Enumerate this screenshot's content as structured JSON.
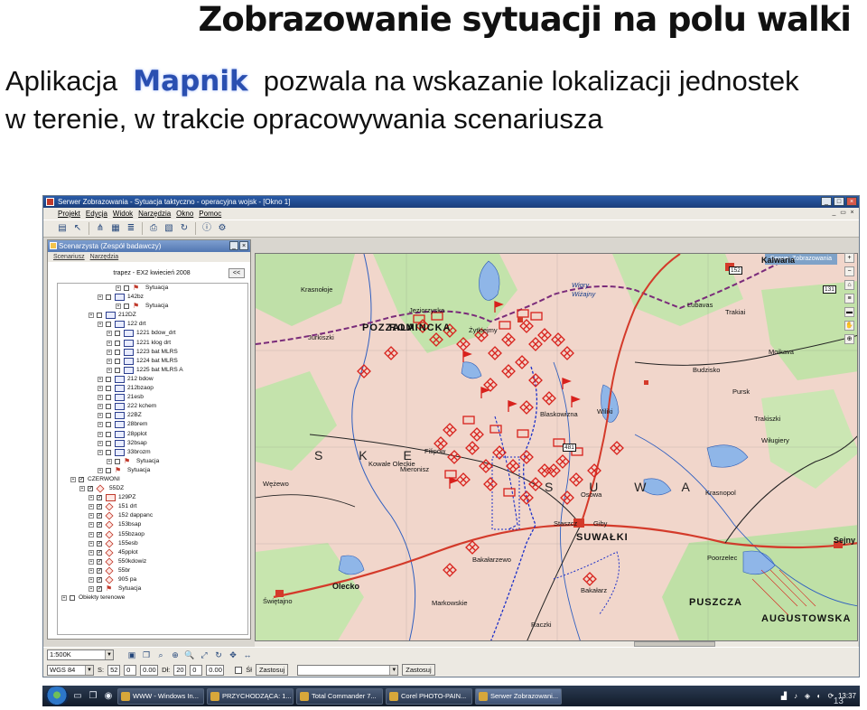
{
  "slide": {
    "title": "Zobrazowanie sytuacji na polu walki",
    "line1_before": "Aplikacja  ",
    "line1_app": "Mapnik",
    "line1_after": "  pozwala na wskazanie lokalizacji jednostek",
    "line2": "w terenie, w trakcie opracowywania scenariusza",
    "page_number": "13"
  },
  "window": {
    "title": "Serwer Zobrazowania - Sytuacja taktyczno - operacyjna wojsk - [Okno 1]",
    "menu": [
      "Projekt",
      "Edycja",
      "Widok",
      "Narzędzia",
      "Okno",
      "Pomoc"
    ],
    "toolbar_icons": [
      "new-icon",
      "cursor-icon",
      "network-icon",
      "grid-icon",
      "layers-icon",
      "print-icon",
      "map-icon",
      "refresh-icon",
      "info-icon",
      "settings-icon"
    ]
  },
  "panel": {
    "title": "Scenarzysta (Zespół badawczy)",
    "menu": [
      "Scenariusz",
      "Narzędzia"
    ],
    "header": "trapez - EX2 kwiecień 2008",
    "header_button": "<<",
    "tree": [
      {
        "label": "Sytuacja",
        "indent": 6,
        "checked": false,
        "sym": "flag"
      },
      {
        "label": "142bz",
        "indent": 4,
        "checked": false,
        "sym": "blue"
      },
      {
        "label": "Sytuacja",
        "indent": 6,
        "checked": false,
        "sym": "flag"
      },
      {
        "label": "212DZ",
        "indent": 3,
        "checked": false,
        "sym": "blue"
      },
      {
        "label": "122 drt",
        "indent": 4,
        "checked": false,
        "sym": "blue"
      },
      {
        "label": "1221 bdow_drt",
        "indent": 5,
        "checked": false,
        "sym": "blue"
      },
      {
        "label": "1221 klog drt",
        "indent": 5,
        "checked": false,
        "sym": "blue"
      },
      {
        "label": "1223 bat MLRS",
        "indent": 5,
        "checked": false,
        "sym": "blue"
      },
      {
        "label": "1224 bat MLRS",
        "indent": 5,
        "checked": false,
        "sym": "blue"
      },
      {
        "label": "1225 bat MLRS A",
        "indent": 5,
        "checked": false,
        "sym": "blue"
      },
      {
        "label": "212 bdow",
        "indent": 4,
        "checked": false,
        "sym": "blue"
      },
      {
        "label": "212bzaop",
        "indent": 4,
        "checked": false,
        "sym": "blue"
      },
      {
        "label": "21esb",
        "indent": 4,
        "checked": false,
        "sym": "blue"
      },
      {
        "label": "222 kchem",
        "indent": 4,
        "checked": false,
        "sym": "blue"
      },
      {
        "label": "22BZ",
        "indent": 4,
        "checked": false,
        "sym": "blue"
      },
      {
        "label": "28brem",
        "indent": 4,
        "checked": false,
        "sym": "blue"
      },
      {
        "label": "28pplot",
        "indent": 4,
        "checked": false,
        "sym": "blue"
      },
      {
        "label": "32bsap",
        "indent": 4,
        "checked": false,
        "sym": "blue"
      },
      {
        "label": "33brozm",
        "indent": 4,
        "checked": false,
        "sym": "blue"
      },
      {
        "label": "Sytuacja",
        "indent": 5,
        "checked": false,
        "sym": "flag"
      },
      {
        "label": "Sytuacja",
        "indent": 4,
        "checked": false,
        "sym": "flag"
      },
      {
        "label": "CZERWONI",
        "indent": 1,
        "checked": true,
        "sym": "none"
      },
      {
        "label": "55DZ",
        "indent": 2,
        "checked": true,
        "sym": "red-dia"
      },
      {
        "label": "129PZ",
        "indent": 3,
        "checked": true,
        "sym": "red"
      },
      {
        "label": "151 drt",
        "indent": 3,
        "checked": true,
        "sym": "red-dia"
      },
      {
        "label": "152 dappanc",
        "indent": 3,
        "checked": true,
        "sym": "red-dia"
      },
      {
        "label": "153bsap",
        "indent": 3,
        "checked": true,
        "sym": "red-dia"
      },
      {
        "label": "155bzaop",
        "indent": 3,
        "checked": true,
        "sym": "red-dia"
      },
      {
        "label": "155esb",
        "indent": 3,
        "checked": true,
        "sym": "red-dia"
      },
      {
        "label": "45pplot",
        "indent": 3,
        "checked": true,
        "sym": "red-dia"
      },
      {
        "label": "550kdowiz",
        "indent": 3,
        "checked": true,
        "sym": "red-dia"
      },
      {
        "label": "55br",
        "indent": 3,
        "checked": true,
        "sym": "red-dia"
      },
      {
        "label": "905 pa",
        "indent": 3,
        "checked": true,
        "sym": "red-dia"
      },
      {
        "label": "Sytuacja",
        "indent": 3,
        "checked": true,
        "sym": "flag"
      },
      {
        "label": "Obiekty terenowe",
        "indent": 0,
        "checked": false,
        "sym": "none"
      }
    ]
  },
  "map": {
    "caption": "Serwer Zobrazowania",
    "labels": [
      {
        "text": "Kalwaria",
        "kind": "bold"
      },
      {
        "text": "POZZALA",
        "kind": "big"
      },
      {
        "text": "ROMINCKA",
        "kind": "big"
      },
      {
        "text": "Jurkiszki",
        "kind": "plain"
      },
      {
        "text": "Krasnołoje",
        "kind": "plain"
      },
      {
        "text": "Żytkiejmy",
        "kind": "plain"
      },
      {
        "text": "Jeziorzyska",
        "kind": "plain"
      },
      {
        "text": "Lubavas",
        "kind": "plain"
      },
      {
        "text": "Trakiai",
        "kind": "plain"
      },
      {
        "text": "Moikava",
        "kind": "plain"
      },
      {
        "text": "Budzisko",
        "kind": "plain"
      },
      {
        "text": "Pursk",
        "kind": "plain"
      },
      {
        "text": "Blaskowizna",
        "kind": "plain"
      },
      {
        "text": "Filipów",
        "kind": "plain"
      },
      {
        "text": "Wiżajny",
        "kind": "water"
      },
      {
        "text": "Wiliki",
        "kind": "plain"
      },
      {
        "text": "Trakiszki",
        "kind": "plain"
      },
      {
        "text": "Wiługiery",
        "kind": "plain"
      },
      {
        "text": "S   K   E",
        "kind": "region"
      },
      {
        "text": "S  U  W  A",
        "kind": "region"
      },
      {
        "text": "Kowale Oleckie",
        "kind": "plain"
      },
      {
        "text": "Wężewo",
        "kind": "plain"
      },
      {
        "text": "Mieronisz",
        "kind": "plain"
      },
      {
        "text": "Osowa",
        "kind": "plain"
      },
      {
        "text": "Krasnopol",
        "kind": "plain"
      },
      {
        "text": "SUWAŁKI",
        "kind": "big"
      },
      {
        "text": "Bakałarzewo",
        "kind": "plain"
      },
      {
        "text": "Staszcz",
        "kind": "plain"
      },
      {
        "text": "Olecko",
        "kind": "bold"
      },
      {
        "text": "Świętajno",
        "kind": "plain"
      },
      {
        "text": "Markowskie",
        "kind": "plain"
      },
      {
        "text": "Raczki",
        "kind": "plain"
      },
      {
        "text": "Bakałarz",
        "kind": "plain"
      },
      {
        "text": "PUSZCZA",
        "kind": "big"
      },
      {
        "text": "AUGUSTOWSKA",
        "kind": "big"
      },
      {
        "text": "Sejny",
        "kind": "bold"
      },
      {
        "text": "Giby",
        "kind": "plain"
      },
      {
        "text": "Poorzelec",
        "kind": "plain"
      },
      {
        "text": "Wigry",
        "kind": "water"
      },
      {
        "text": "481",
        "kind": "num"
      },
      {
        "text": "131",
        "kind": "num"
      },
      {
        "text": "152",
        "kind": "num"
      }
    ],
    "right_tools": [
      "zoom-in-icon",
      "zoom-out-icon",
      "home-icon",
      "layer-icon",
      "folder-icon",
      "hand-icon",
      "target-icon"
    ]
  },
  "statusbar": {
    "scale": "1:500K",
    "scale_icons": [
      "image-icon",
      "copy-icon",
      "magnify-icon",
      "zoom-icon",
      "search-icon",
      "fit-icon",
      "refresh-icon",
      "pan-icon",
      "measure-icon"
    ],
    "datum": "WGS 84",
    "s_label": "S:",
    "s_value": "52",
    "s_min": "0",
    "s_sec": "0.00",
    "d_label": "Dł:",
    "d_value": "20",
    "d_min": "0",
    "d_sec": "0.00",
    "si_label": "Śł",
    "apply_button": "Zastosuj",
    "combo_value": "",
    "apply_button2": "Zastosuj"
  },
  "taskbar": {
    "tasks": [
      {
        "label": "WWW - Windows In...",
        "active": false
      },
      {
        "label": "PRZYCHODZĄCA: 1...",
        "active": false
      },
      {
        "label": "Total Commander 7...",
        "active": false
      },
      {
        "label": "Corel PHOTO-PAIN...",
        "active": false
      },
      {
        "label": "Serwer Zobrazowani...",
        "active": true
      }
    ],
    "clock": "13:37"
  }
}
